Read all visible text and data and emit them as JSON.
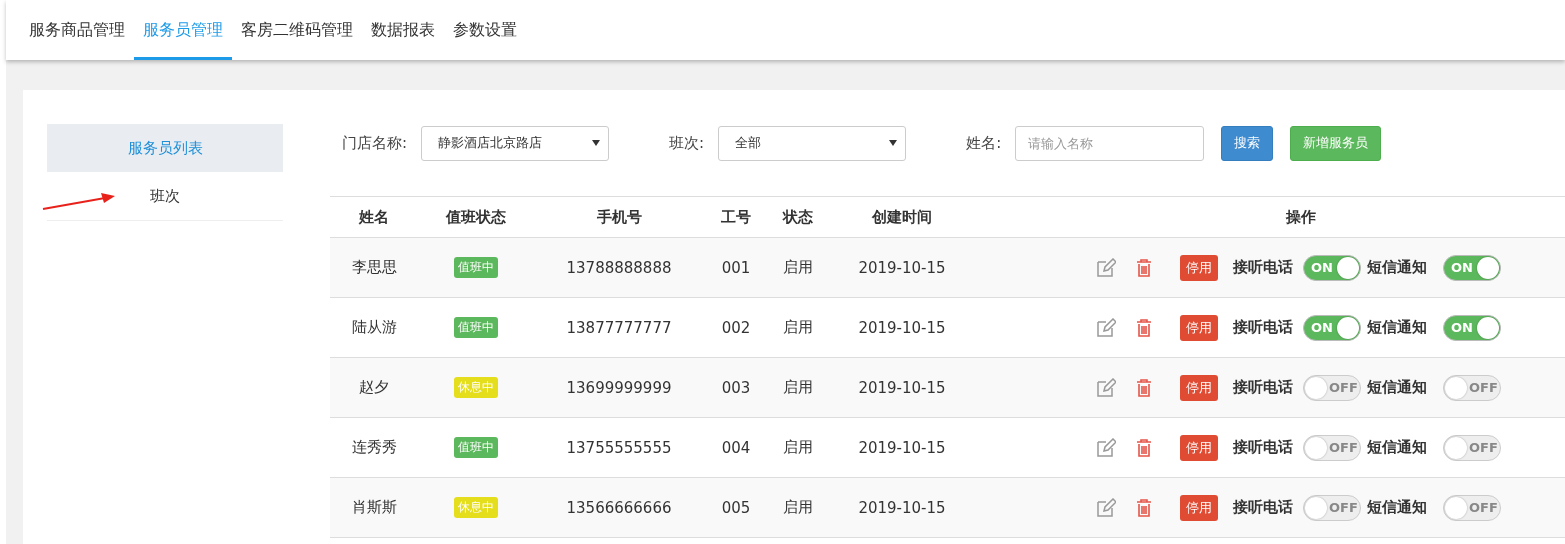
{
  "nav_tabs": [
    {
      "label": "服务商品管理",
      "selected": false
    },
    {
      "label": "服务员管理",
      "selected": true
    },
    {
      "label": "客房二维码管理",
      "selected": false
    },
    {
      "label": "数据报表",
      "selected": false
    },
    {
      "label": "参数设置",
      "selected": false
    }
  ],
  "sidebar": {
    "items": [
      {
        "label": "服务员列表",
        "selected": true
      },
      {
        "label": "班次",
        "selected": false
      }
    ]
  },
  "filters": {
    "store": {
      "label": "门店名称:",
      "value": "静影酒店北京路店"
    },
    "shift": {
      "label": "班次:",
      "value": "全部"
    },
    "name": {
      "label": "姓名:",
      "placeholder": "请输入名称"
    },
    "search_button": "搜索",
    "add_button": "新增服务员"
  },
  "table": {
    "columns": [
      "姓名",
      "值班状态",
      "手机号",
      "工号",
      "状态",
      "创建时间",
      "操作"
    ],
    "rows": [
      {
        "name": "李思思",
        "duty": {
          "label": "值班中",
          "kind": "on_duty"
        },
        "phone": "13788888888",
        "employee_no": "001",
        "status": "启用",
        "created": "2019-10-15",
        "action": "停用",
        "call_label": "接听电话",
        "call_toggle": {
          "on": true,
          "text": "ON"
        },
        "sms_label": "短信通知",
        "sms_toggle": {
          "on": true,
          "text": "ON"
        }
      },
      {
        "name": "陆从游",
        "duty": {
          "label": "值班中",
          "kind": "on_duty"
        },
        "phone": "13877777777",
        "employee_no": "002",
        "status": "启用",
        "created": "2019-10-15",
        "action": "停用",
        "call_label": "接听电话",
        "call_toggle": {
          "on": true,
          "text": "ON"
        },
        "sms_label": "短信通知",
        "sms_toggle": {
          "on": true,
          "text": "ON"
        }
      },
      {
        "name": "赵夕",
        "duty": {
          "label": "休息中",
          "kind": "resting"
        },
        "phone": "13699999999",
        "employee_no": "003",
        "status": "启用",
        "created": "2019-10-15",
        "action": "停用",
        "call_label": "接听电话",
        "call_toggle": {
          "on": false,
          "text": "OFF"
        },
        "sms_label": "短信通知",
        "sms_toggle": {
          "on": false,
          "text": "OFF"
        }
      },
      {
        "name": "连秀秀",
        "duty": {
          "label": "值班中",
          "kind": "on_duty"
        },
        "phone": "13755555555",
        "employee_no": "004",
        "status": "启用",
        "created": "2019-10-15",
        "action": "停用",
        "call_label": "接听电话",
        "call_toggle": {
          "on": false,
          "text": "OFF"
        },
        "sms_label": "短信通知",
        "sms_toggle": {
          "on": false,
          "text": "OFF"
        }
      },
      {
        "name": "肖斯斯",
        "duty": {
          "label": "休息中",
          "kind": "resting"
        },
        "phone": "13566666666",
        "employee_no": "005",
        "status": "启用",
        "created": "2019-10-15",
        "action": "停用",
        "call_label": "接听电话",
        "call_toggle": {
          "on": false,
          "text": "OFF"
        },
        "sms_label": "短信通知",
        "sms_toggle": {
          "on": false,
          "text": "OFF"
        }
      }
    ]
  }
}
